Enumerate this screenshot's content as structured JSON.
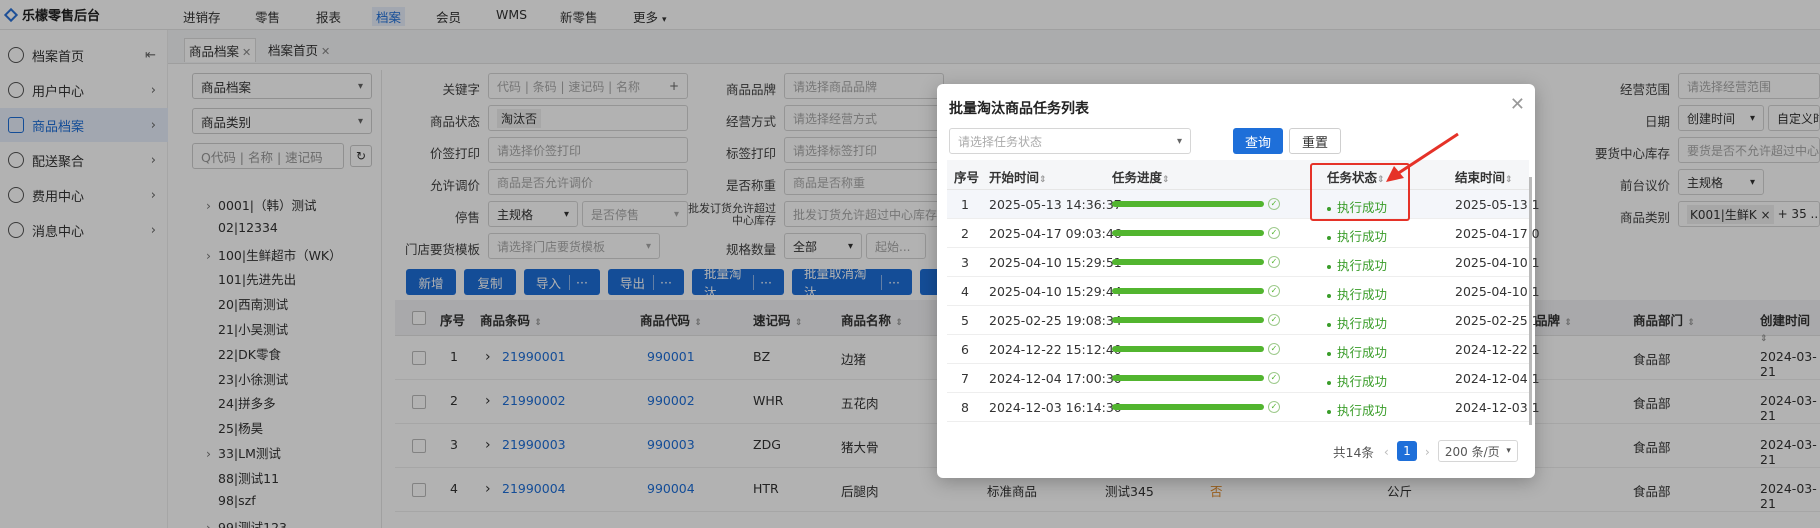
{
  "app": {
    "title": "乐檬零售后台"
  },
  "topnav": [
    "进销存",
    "零售",
    "报表",
    "档案",
    "会员",
    "WMS",
    "新零售",
    "更多"
  ],
  "topnav_active": "档案",
  "sidebar": {
    "collapse_icon": "collapse-left-icon",
    "items": [
      {
        "label": "档案首页",
        "icon": "home-icon"
      },
      {
        "label": "用户中心",
        "icon": "user-icon"
      },
      {
        "label": "商品档案",
        "icon": "product-icon"
      },
      {
        "label": "配送聚合",
        "icon": "delivery-icon"
      },
      {
        "label": "费用中心",
        "icon": "cost-icon"
      },
      {
        "label": "消息中心",
        "icon": "bell-icon"
      }
    ]
  },
  "tabs": [
    {
      "label": "商品档案"
    },
    {
      "label": "档案首页"
    }
  ],
  "tree": {
    "select1": "商品档案",
    "select2": "商品类别",
    "search_placeholder": "Q代码 | 名称 | 速记码",
    "nodes": [
      {
        "label": "0001|（韩）测试",
        "caret": "›"
      },
      {
        "label": "02|12334",
        "caret": ""
      },
      {
        "label": "100|生鲜超市（WK）",
        "caret": "›"
      },
      {
        "label": "101|先进先出",
        "caret": ""
      },
      {
        "label": "20|西南测试",
        "caret": ""
      },
      {
        "label": "21|小吴测试",
        "caret": ""
      },
      {
        "label": "22|DK零食",
        "caret": ""
      },
      {
        "label": "23|小徐测试",
        "caret": ""
      },
      {
        "label": "24|拼多多",
        "caret": ""
      },
      {
        "label": "25|杨昊",
        "caret": ""
      },
      {
        "label": "33|LM测试",
        "caret": "›"
      },
      {
        "label": "88|测试11",
        "caret": ""
      },
      {
        "label": "98|szf",
        "caret": ""
      },
      {
        "label": "99|测试123",
        "caret": "›"
      }
    ]
  },
  "filters": {
    "keyword_label": "关键字",
    "keyword_placeholder": "代码 | 条码 | 速记码 | 名称",
    "status_label": "商品状态",
    "status_value": "淘汰否",
    "price_print_label": "价签打印",
    "price_print_placeholder": "请选择价签打印",
    "allow_price_label": "允许调价",
    "allow_price_placeholder": "商品是否允许调价",
    "sale_label": "停售",
    "sale_value": "主规格",
    "sale_value2": "是否停售",
    "store_template_label": "门店要货模板",
    "store_template_placeholder": "请选择门店要货模板",
    "brand_label": "商品品牌",
    "brand_placeholder": "请选择商品品牌",
    "mode_label": "经营方式",
    "mode_placeholder": "请选择经营方式",
    "tag_label": "标签打印",
    "tag_placeholder": "请选择标签打印",
    "weigh_label": "是否称重",
    "weigh_placeholder": "商品是否称重",
    "batch_label": "批发订货允许超过中心库存",
    "batch_placeholder": "批发订货允许超过中心库存",
    "spec_label": "规格数量",
    "spec_value": "全部",
    "spec_start": "起始...",
    "range_label": "经营范围",
    "range_placeholder": "请选择经营范围",
    "date_label": "日期",
    "date_value": "创建时间",
    "date_custom": "自定义时",
    "center_stock_label": "要货中心库存",
    "center_stock_placeholder": "要货是否不允许超过中心",
    "front_price_label": "前台议价",
    "front_price_value": "主规格",
    "category_label": "商品类别",
    "category_value": "K001|生鲜K ×",
    "category_more": "+ 35 ..."
  },
  "toolbar": {
    "add": "新增",
    "copy": "复制",
    "import": "导入",
    "export": "导出",
    "batch_eliminate": "批量淘汰",
    "batch_cancel": "批量取消淘汰",
    "more_icon": "ellipsis-icon"
  },
  "table": {
    "headers": [
      "序号",
      "商品条码",
      "商品代码",
      "速记码",
      "商品名称",
      "品牌",
      "商品部门",
      "创建时间"
    ],
    "rows": [
      {
        "no": "1",
        "barcode": "21990001",
        "code": "990001",
        "short": "BZ",
        "name": "边猪",
        "dept": "食品部",
        "created": "2024-03-21"
      },
      {
        "no": "2",
        "barcode": "21990002",
        "code": "990002",
        "short": "WHR",
        "name": "五花肉",
        "dept": "食品部",
        "created": "2024-03-21"
      },
      {
        "no": "3",
        "barcode": "21990003",
        "code": "990003",
        "short": "ZDG",
        "name": "猪大骨",
        "dept": "食品部",
        "created": "2024-03-21"
      },
      {
        "no": "4",
        "barcode": "21990004",
        "code": "990004",
        "short": "HTR",
        "name": "后腿肉",
        "type": "标准商品",
        "spec": "测试345",
        "flag": "否",
        "unit": "公斤",
        "dept": "食品部",
        "created": "2024-03-21"
      }
    ]
  },
  "modal": {
    "title": "批量淘汰商品任务列表",
    "status_placeholder": "请选择任务状态",
    "query": "查询",
    "reset": "重置",
    "headers": [
      "序号",
      "开始时间",
      "任务进度",
      "任务状态",
      "结束时间"
    ],
    "rows": [
      {
        "no": "1",
        "start": "2025-05-13 14:36:37",
        "progress": 100,
        "status": "执行成功",
        "end": "2025-05-13 1"
      },
      {
        "no": "2",
        "start": "2025-04-17 09:03:46",
        "progress": 100,
        "status": "执行成功",
        "end": "2025-04-17 0"
      },
      {
        "no": "3",
        "start": "2025-04-10 15:29:51",
        "progress": 100,
        "status": "执行成功",
        "end": "2025-04-10 1"
      },
      {
        "no": "4",
        "start": "2025-04-10 15:29:44",
        "progress": 100,
        "status": "执行成功",
        "end": "2025-04-10 1"
      },
      {
        "no": "5",
        "start": "2025-02-25 19:08:34",
        "progress": 100,
        "status": "执行成功",
        "end": "2025-02-25 1"
      },
      {
        "no": "6",
        "start": "2024-12-22 15:12:40",
        "progress": 100,
        "status": "执行成功",
        "end": "2024-12-22 1"
      },
      {
        "no": "7",
        "start": "2024-12-04 17:00:30",
        "progress": 100,
        "status": "执行成功",
        "end": "2024-12-04 1"
      },
      {
        "no": "8",
        "start": "2024-12-03 16:14:30",
        "progress": 100,
        "status": "执行成功",
        "end": "2024-12-03 1"
      }
    ],
    "total": "共14条",
    "page": "1",
    "page_size": "200 条/页"
  },
  "colors": {
    "primary": "#1e6fd9",
    "success": "#3a9d2a",
    "progress": "#52b52f",
    "highlight": "#e53228"
  }
}
